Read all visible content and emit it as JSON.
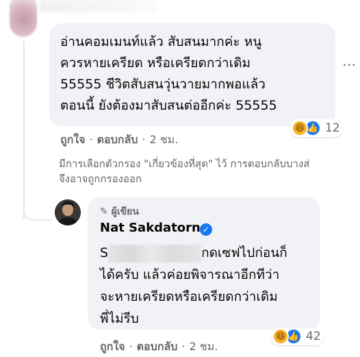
{
  "comment": {
    "lines": [
      "อ่านคอมเมนท์แล้ว สับสนมากค่ะ หนู",
      "ควรหายเครียด หรือเครียดกว่าเดิม",
      "55555 ชีวิตสับสนวุ่นวายมากพอแล้ว",
      "ตอนนี้ ยังต้องมาสับสนต่ออีกค่ะ 55555"
    ],
    "reaction_count": "12",
    "like_label": "ถูกใจ",
    "reply_label": "ตอบกลับ",
    "time": "2 ชม.",
    "more_icon": "⋯"
  },
  "filter_note": {
    "line1": "มีการเลือกตัวกรอง \"เกี่ยวข้องที่สุด\" ไว้ การตอบกลับบางส่",
    "line2": "จึงอาจถูกกรองออก"
  },
  "reply": {
    "author_tag": "ผู้เขียน",
    "author_name": "Nat Sakdatorn",
    "first_char": "S",
    "line1_rest": "กดเซฟไปก่อนก็",
    "lines": [
      "ได้ครับ แล้วค่อยพิจารณาอีกทีว่า",
      "จะหายเครียดหรือเครียดกว่าเดิม",
      "พี่ไม่รีบ"
    ],
    "reaction_count": "42",
    "like_label": "ถูกใจ",
    "reply_label": "ตอบกลับ",
    "time": "2 ชม."
  },
  "colors": {
    "bubble": "#f0f2f5",
    "secondary_text": "#65676b",
    "accent": "#1877f2"
  },
  "icons": {
    "haha": "😆",
    "like": "👍",
    "pencil": "✎",
    "check": "✓"
  }
}
